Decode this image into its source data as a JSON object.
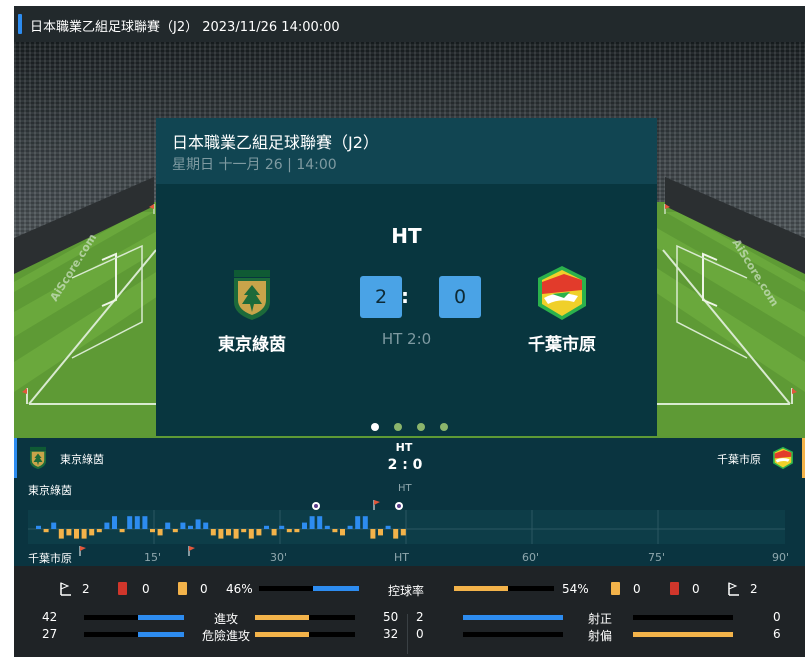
{
  "header": {
    "title": "日本職業乙組足球聯賽（J2）  2023/11/26 14:00:00"
  },
  "card": {
    "league": "日本職業乙組足球聯賽（J2）",
    "date": "星期日 十一月 26 | 14:00",
    "status": "HT",
    "home_score": "2",
    "separator": ":",
    "away_score": "0",
    "half_time": "HT 2:0",
    "home_team": "東京綠茵",
    "away_team": "千葉市原",
    "watermark": "AiScore.com"
  },
  "carousel": {
    "count": 4,
    "active": 0
  },
  "score_bar": {
    "home_team": "東京綠茵",
    "away_team": "千葉市原",
    "status": "HT",
    "score": "2 : 0"
  },
  "timeline": {
    "home_label": "東京綠茵",
    "away_label": "千葉市原",
    "ht_label": "HT",
    "ticks": [
      "15'",
      "30'",
      "HT",
      "60'",
      "75'",
      "90'"
    ],
    "colors": {
      "home": "#2d8cf0",
      "away": "#f3b34a"
    }
  },
  "stats": {
    "home_corners": "2",
    "home_red": "0",
    "home_yellow": "0",
    "home_possession": "46%",
    "possession_label": "控球率",
    "away_possession": "54%",
    "away_yellow": "0",
    "away_red": "0",
    "away_corners": "2",
    "possession_home_fraction": 0.46,
    "rows_left": [
      {
        "home": "42",
        "label": "進攻",
        "away": "50",
        "home_frac": 0.46,
        "away_frac": 0.54
      },
      {
        "home": "27",
        "label": "危險進攻",
        "away": "32",
        "home_frac": 0.46,
        "away_frac": 0.54
      }
    ],
    "rows_right": [
      {
        "home": "2",
        "label": "射正",
        "away": "0",
        "home_frac": 1.0,
        "away_frac": 0.0
      },
      {
        "home": "0",
        "label": "射偏",
        "away": "6",
        "home_frac": 0.0,
        "away_frac": 1.0
      }
    ],
    "colors": {
      "home": "#2d8cf0",
      "away": "#f3b34a",
      "red_card": "#d0362b",
      "yellow_card": "#f3b34a"
    }
  }
}
